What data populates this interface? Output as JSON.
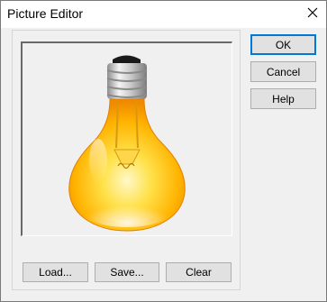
{
  "window": {
    "title": "Picture Editor"
  },
  "picture": {
    "icon": "light-bulb-icon"
  },
  "buttons": {
    "load": "Load...",
    "save": "Save...",
    "clear": "Clear",
    "ok": "OK",
    "cancel": "Cancel",
    "help": "Help"
  },
  "colors": {
    "accent": "#0078d7",
    "bulb_glass": "#ffc21a",
    "bulb_base": "#c0c0c0"
  }
}
